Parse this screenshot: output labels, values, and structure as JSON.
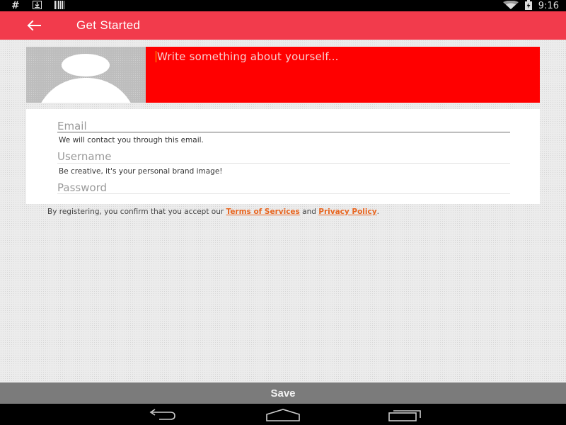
{
  "status_bar": {
    "time": "9:16",
    "icons": [
      "hash-icon",
      "download-icon",
      "barcode-icon",
      "wifi-icon",
      "battery-icon"
    ],
    "hash_glyph": "#"
  },
  "app_bar": {
    "title": "Get Started",
    "back_icon": "back-arrow-icon",
    "background": "#f23b4c"
  },
  "profile": {
    "about_text": "Write something about yourself...",
    "about_background": "#ff0000",
    "avatar_icon": "avatar-placeholder-icon"
  },
  "form": {
    "email": {
      "label": "Email",
      "hint": "We will contact you through this email."
    },
    "username": {
      "label": "Username",
      "hint": "Be creative, it's your personal brand image!"
    },
    "password": {
      "label": "Password"
    }
  },
  "terms": {
    "prefix": "By registering, you confirm that you accept our ",
    "terms_link": "Terms of Services",
    "and": " and ",
    "privacy_link": "Privacy Policy",
    "suffix": ".",
    "link_color": "#e8651f"
  },
  "save_button": {
    "label": "Save"
  },
  "nav_bar": {
    "icons": [
      "back-nav-icon",
      "home-nav-icon",
      "recents-nav-icon"
    ]
  }
}
